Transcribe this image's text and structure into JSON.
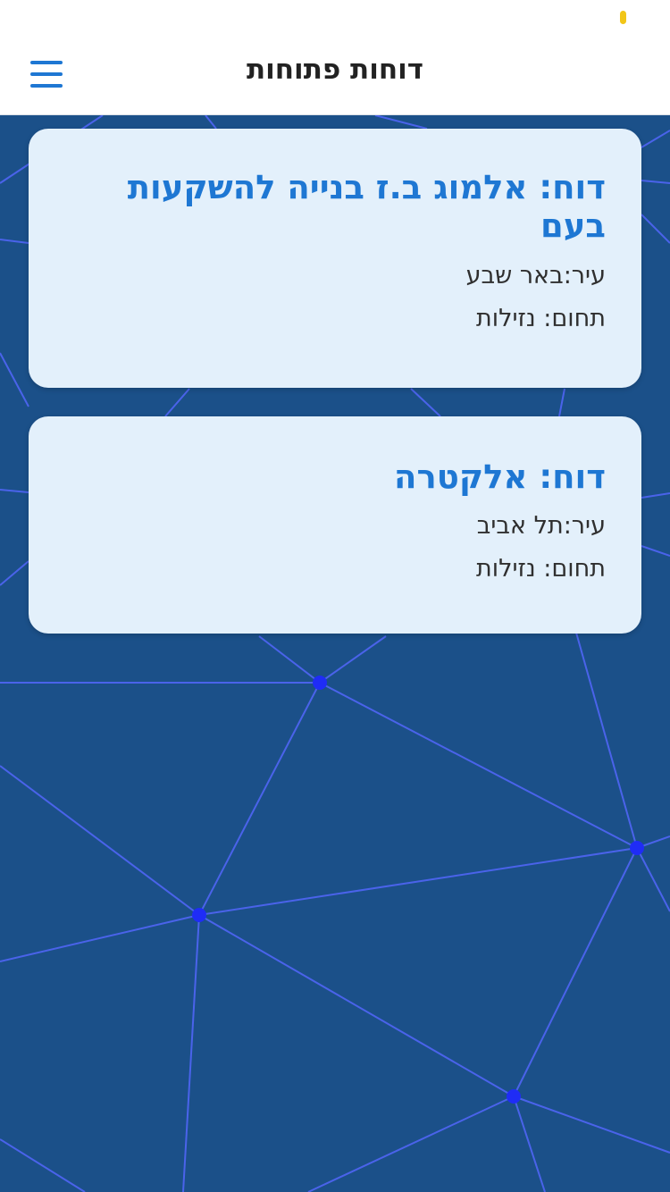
{
  "header": {
    "title": "דוחות פתוחות"
  },
  "icons": {
    "menu": "hamburger-menu-icon",
    "status": "status-indicator-icon"
  },
  "colors": {
    "accent": "#1e77d3",
    "status_dot": "#f2c618",
    "background": "#1b5089",
    "network_line": "#4a63ea",
    "network_node": "#1f2cf6",
    "card_background": "#e3f0fb",
    "text": "#2f2f2f"
  },
  "reports": [
    {
      "title": "דוח: אלמוג ב.ז בנייה להשקעות בעם",
      "city": "עיר:באר שבע",
      "field": "תחום: נזילות"
    },
    {
      "title": "דוח: אלקטרה",
      "city": "עיר:תל אביב",
      "field": "תחום: נזילות"
    }
  ]
}
